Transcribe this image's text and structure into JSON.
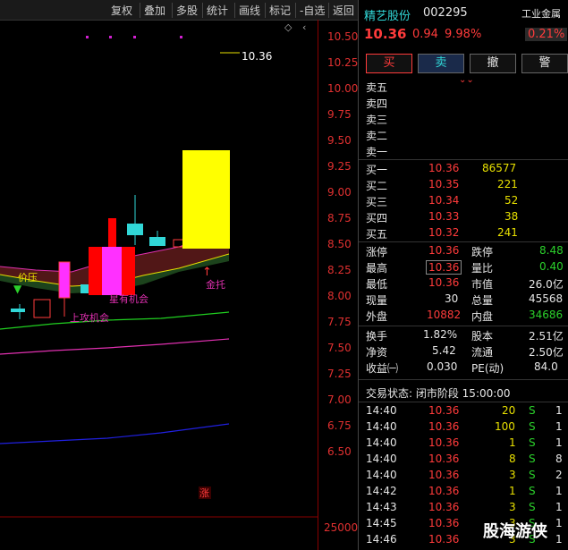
{
  "toolbar": {
    "items": [
      "复权",
      "叠加",
      "多股",
      "统计",
      "画线",
      "标记",
      "-自选",
      "返回"
    ]
  },
  "chart": {
    "y_ticks": [
      "10.50",
      "10.25",
      "10.00",
      "9.75",
      "9.50",
      "9.25",
      "9.00",
      "8.75",
      "8.50",
      "8.25",
      "8.00",
      "7.75",
      "7.50",
      "7.25",
      "7.00",
      "6.75",
      "6.50"
    ],
    "price_marker": "10.36",
    "labels": {
      "jiaya": "价压",
      "shangyou": "星有机会",
      "shanggong": "上攻机会",
      "jintuo": "金托",
      "zhang": "涨"
    },
    "volume_tick": "25000"
  },
  "stock": {
    "name": "精艺股份",
    "code": "002295",
    "sector_label": "工业金属",
    "price": "10.36",
    "change": "0.94",
    "change_pct": "9.98%",
    "sector_pct": "0.21%"
  },
  "actions": {
    "buy": "买",
    "sell": "卖",
    "cancel": "撤",
    "alert": "警"
  },
  "asks": [
    {
      "label": "卖五",
      "price": "",
      "vol": ""
    },
    {
      "label": "卖四",
      "price": "",
      "vol": ""
    },
    {
      "label": "卖三",
      "price": "",
      "vol": ""
    },
    {
      "label": "卖二",
      "price": "",
      "vol": ""
    },
    {
      "label": "卖一",
      "price": "",
      "vol": ""
    }
  ],
  "bids": [
    {
      "label": "买一",
      "price": "10.36",
      "vol": "86577"
    },
    {
      "label": "买二",
      "price": "10.35",
      "vol": "221"
    },
    {
      "label": "买三",
      "price": "10.34",
      "vol": "52"
    },
    {
      "label": "买四",
      "price": "10.33",
      "vol": "38"
    },
    {
      "label": "买五",
      "price": "10.32",
      "vol": "241"
    }
  ],
  "stats": {
    "zhangting_l": "涨停",
    "zhangting": "10.36",
    "dieting_l": "跌停",
    "dieting": "8.48",
    "zuigao_l": "最高",
    "zuigao": "10.36",
    "liangbi_l": "量比",
    "liangbi": "0.40",
    "zuidi_l": "最低",
    "zuidi": "10.36",
    "shizhi_l": "市值",
    "shizhi": "26.0亿",
    "xianliang_l": "现量",
    "xianliang": "30",
    "zongliang_l": "总量",
    "zongliang": "45568",
    "waipan_l": "外盘",
    "waipan": "10882",
    "neipan_l": "内盘",
    "neipan": "34686",
    "huanshou_l": "换手",
    "huanshou": "1.82%",
    "guben_l": "股本",
    "guben": "2.51亿",
    "jingzi_l": "净资",
    "jingzi": "5.42",
    "liutong_l": "流通",
    "liutong": "2.50亿",
    "shouyi_l": "收益㈠",
    "shouyi": "0.030",
    "pe_l": "PE(动)",
    "pe": "84.0"
  },
  "trade_status": "交易状态: 闭市阶段 15:00:00",
  "ticks": [
    {
      "time": "14:40",
      "price": "10.36",
      "vol": "20",
      "side": "S",
      "n": "1"
    },
    {
      "time": "14:40",
      "price": "10.36",
      "vol": "100",
      "side": "S",
      "n": "1"
    },
    {
      "time": "14:40",
      "price": "10.36",
      "vol": "1",
      "side": "S",
      "n": "1"
    },
    {
      "time": "14:40",
      "price": "10.36",
      "vol": "8",
      "side": "S",
      "n": "8"
    },
    {
      "time": "14:40",
      "price": "10.36",
      "vol": "3",
      "side": "S",
      "n": "2"
    },
    {
      "time": "14:42",
      "price": "10.36",
      "vol": "1",
      "side": "S",
      "n": "1"
    },
    {
      "time": "14:43",
      "price": "10.36",
      "vol": "3",
      "side": "S",
      "n": "1"
    },
    {
      "time": "14:45",
      "price": "10.36",
      "vol": "3",
      "side": "S",
      "n": "1"
    },
    {
      "time": "14:46",
      "price": "10.36",
      "vol": "3",
      "side": "S",
      "n": "1"
    }
  ],
  "watermark": "股海游侠"
}
